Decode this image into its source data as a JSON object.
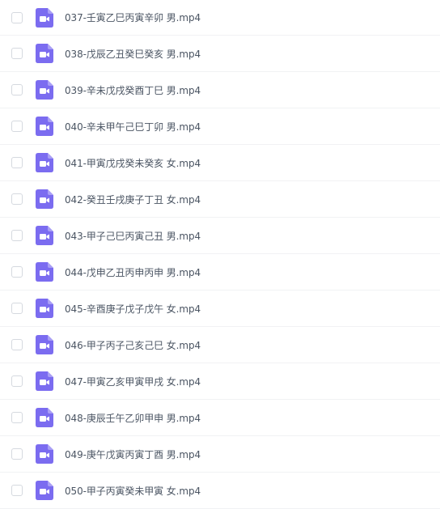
{
  "files": [
    {
      "name": "037-壬寅乙巳丙寅辛卯 男.mp4"
    },
    {
      "name": "038-戊辰乙丑癸巳癸亥 男.mp4"
    },
    {
      "name": "039-辛未戊戌癸酉丁巳 男.mp4"
    },
    {
      "name": "040-辛未甲午己巳丁卯 男.mp4"
    },
    {
      "name": "041-甲寅戊戌癸未癸亥 女.mp4"
    },
    {
      "name": "042-癸丑壬戌庚子丁丑 女.mp4"
    },
    {
      "name": "043-甲子己巳丙寅己丑 男.mp4"
    },
    {
      "name": "044-戊申乙丑丙申丙申 男.mp4"
    },
    {
      "name": "045-辛酉庚子戊子戊午 女.mp4"
    },
    {
      "name": "046-甲子丙子己亥己巳 女.mp4"
    },
    {
      "name": "047-甲寅乙亥甲寅甲戌 女.mp4"
    },
    {
      "name": "048-庚辰壬午乙卯甲申 男.mp4"
    },
    {
      "name": "049-庚午戊寅丙寅丁酉 男.mp4"
    },
    {
      "name": "050-甲子丙寅癸未甲寅 女.mp4"
    }
  ],
  "icon": {
    "name": "video-file-icon",
    "color": "#7b6cf0"
  }
}
